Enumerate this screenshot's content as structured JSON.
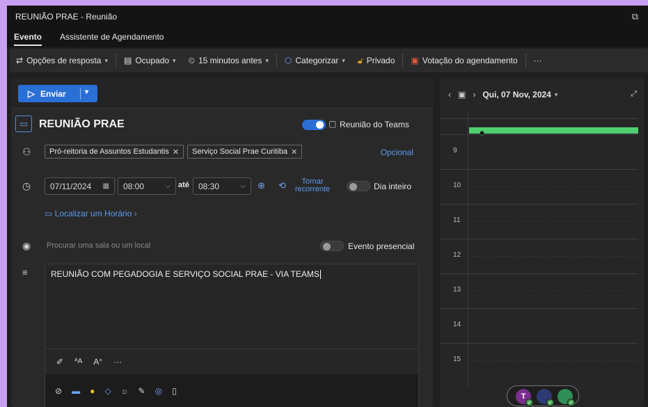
{
  "window": {
    "title": "REUNIÃO PRAE - Reunião"
  },
  "tabs": [
    {
      "label": "Evento",
      "active": true
    },
    {
      "label": "Assistente de Agendamento",
      "active": false
    }
  ],
  "toolbar": {
    "response_options": "Opções de resposta",
    "busy_status": "Ocupado",
    "reminder": "15 minutos antes",
    "categorize": "Categorizar",
    "private": "Privado",
    "scheduling_poll": "Votação do agendamento",
    "more": "···"
  },
  "send": {
    "label": "Enviar"
  },
  "event": {
    "title": "REUNIÃO PRAE",
    "teams_meeting": {
      "label": "Reunião do Teams",
      "on": true
    },
    "attendees": [
      "Pró-reitoria de Assuntos Estudantis",
      "Serviço Social Prae Curitiba"
    ],
    "optional_label": "Opcional",
    "start_date": "07/11/2024",
    "start_time": "08:00",
    "until_label": "até",
    "end_time": "08:30",
    "recurring_label_1": "Tornar",
    "recurring_label_2": "recorrente",
    "all_day": {
      "label": "Dia inteiro",
      "on": false
    },
    "find_time": "Localizar um Horário",
    "location_placeholder": "Procurar uma sala ou um local",
    "in_person": {
      "label": "Evento presencial",
      "on": false
    },
    "body": "REUNIÃO COM PEGADOGIA E SERVIÇO SOCIAL PRAE - VIA TEAMS"
  },
  "calendar": {
    "date": "Qui, 07 Nov, 2024",
    "hours": [
      "9",
      "10",
      "11",
      "12",
      "13",
      "14",
      "15"
    ]
  },
  "avatars": [
    {
      "initial": "T",
      "color": "#7a2f8f"
    },
    {
      "initial": "",
      "color": "#2d3a73"
    },
    {
      "initial": "",
      "color": "#2f8f56"
    }
  ]
}
